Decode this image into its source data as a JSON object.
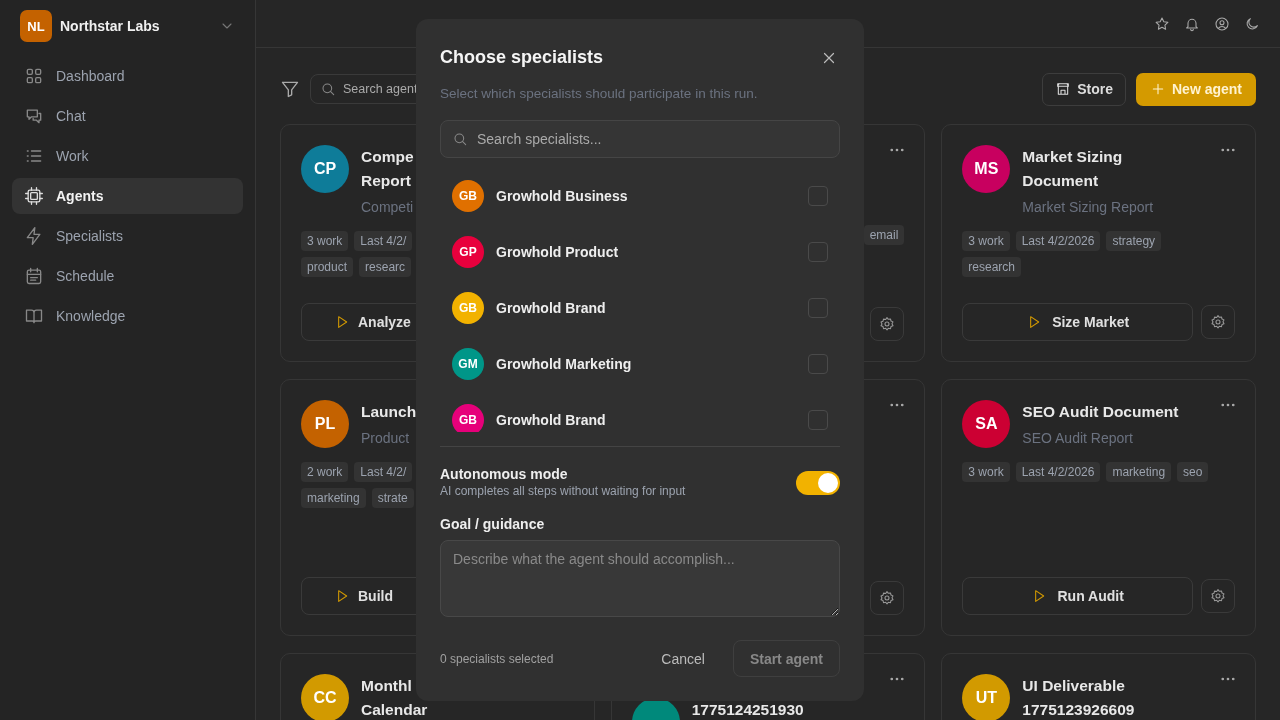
{
  "sidebar": {
    "brand": {
      "initials": "NL",
      "name": "Northstar Labs",
      "color": "#c46200"
    },
    "items": [
      {
        "label": "Dashboard",
        "selected": false
      },
      {
        "label": "Chat",
        "selected": false
      },
      {
        "label": "Work",
        "selected": false
      },
      {
        "label": "Agents",
        "selected": true
      },
      {
        "label": "Specialists",
        "selected": false
      },
      {
        "label": "Schedule",
        "selected": false
      },
      {
        "label": "Knowledge",
        "selected": false
      }
    ]
  },
  "toolbar": {
    "search": {
      "placeholder": "Search agent"
    },
    "buttons": [
      {
        "label": "Store",
        "kind": "secondary"
      },
      {
        "label": "New agent",
        "kind": "primary"
      }
    ]
  },
  "cards": [
    {
      "kind": "left_strip",
      "initials": "CP",
      "color": "#0e7c99",
      "title_lines": [
        "Compe",
        "Report"
      ],
      "subtitle": "Competi",
      "tag_rows": [
        [
          "3 work",
          "Last 4/2/"
        ],
        [
          "product",
          "researc"
        ]
      ],
      "action": "Analyze"
    },
    {
      "kind": "right_strip",
      "tag_rows": [
        [
          "email"
        ]
      ]
    },
    {
      "kind": "full",
      "initials": "MS",
      "color": "#c8005f",
      "title_lines": [
        "Market Sizing",
        "Document"
      ],
      "subtitle": "Market Sizing Report",
      "tag_rows": [
        [
          "3 work",
          "Last 4/2/2026",
          "strategy"
        ],
        [
          "research"
        ]
      ],
      "action": "Size Market"
    },
    {
      "kind": "left_strip",
      "initials": "PL",
      "color": "#c46200",
      "title_lines": [
        "Launch"
      ],
      "subtitle": "Product",
      "tag_rows": [
        [
          "2 work",
          "Last 4/2/"
        ],
        [
          "marketing",
          "strate"
        ]
      ],
      "action": "Build"
    },
    {
      "kind": "right_strip"
    },
    {
      "kind": "full",
      "initials": "SA",
      "color": "#cc0033",
      "title_lines": [
        "SEO Audit Document"
      ],
      "subtitle": "SEO Audit Report",
      "tag_rows": [
        [
          "3 work",
          "Last 4/2/2026",
          "marketing",
          "seo"
        ]
      ],
      "action": "Run Audit"
    },
    {
      "kind": "left_strip",
      "initials": "CC",
      "color": "#d29a00",
      "title_lines": [
        "Monthl",
        "Calendar"
      ]
    },
    {
      "kind": "bottom_strip",
      "color": "#00897b",
      "title_lines": [
        "1775124251930"
      ]
    },
    {
      "kind": "full",
      "initials": "UT",
      "color": "#d29a00",
      "title_lines": [
        "UI Deliverable",
        "1775123926609"
      ]
    }
  ],
  "dialog": {
    "title": "Choose specialists",
    "subtitle": "Select which specialists should participate in this run.",
    "search": {
      "placeholder": "Search specialists..."
    },
    "specialists": [
      {
        "initials": "GB",
        "name": "Growhold Business",
        "color": "#e07000",
        "checked": false
      },
      {
        "initials": "GP",
        "name": "Growhold Product",
        "color": "#e8003d",
        "checked": false
      },
      {
        "initials": "GB",
        "name": "Growhold Brand",
        "color": "#f2b200",
        "checked": false
      },
      {
        "initials": "GM",
        "name": "Growhold Marketing",
        "color": "#009688",
        "checked": false
      },
      {
        "initials": "GB",
        "name": "Growhold Brand",
        "color": "#e6007a",
        "checked": false
      }
    ],
    "autonomous": {
      "label": "Autonomous mode",
      "description": "AI completes all steps without waiting for input",
      "on": true
    },
    "goal": {
      "label": "Goal / guidance",
      "placeholder": "Describe what the agent should accomplish..."
    },
    "selected_count": "0 specialists selected",
    "cancel": "Cancel",
    "start": {
      "label": "Start agent",
      "disabled": true
    }
  }
}
